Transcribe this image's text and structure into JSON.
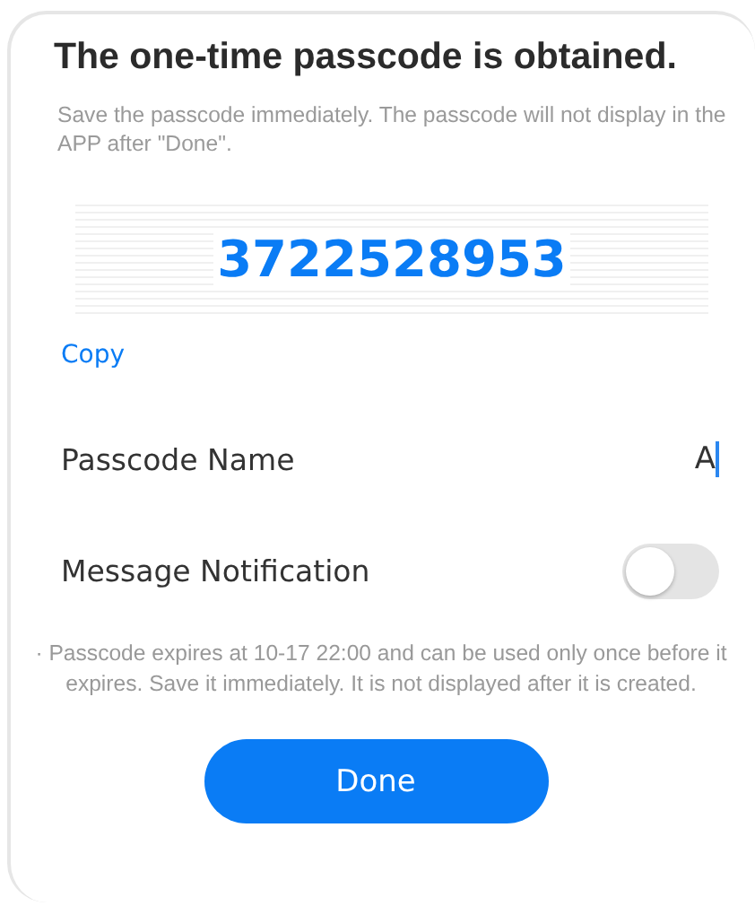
{
  "dialog": {
    "title": "The one-time passcode is obtained.",
    "subtitle": "Save the passcode immediately. The passcode will not display in the APP after \"Done\".",
    "passcode": "3722528953",
    "copy_link": "Copy",
    "fields": [
      {
        "kind": "text",
        "label": "Passcode Name",
        "value": "A"
      },
      {
        "kind": "toggle",
        "label": "Message Notification",
        "on": false
      }
    ],
    "note": "· Passcode expires at 10-17 22:00 and can be used only once before it expires. Save it immediately. It is not displayed after it is created.",
    "button": "Done"
  }
}
